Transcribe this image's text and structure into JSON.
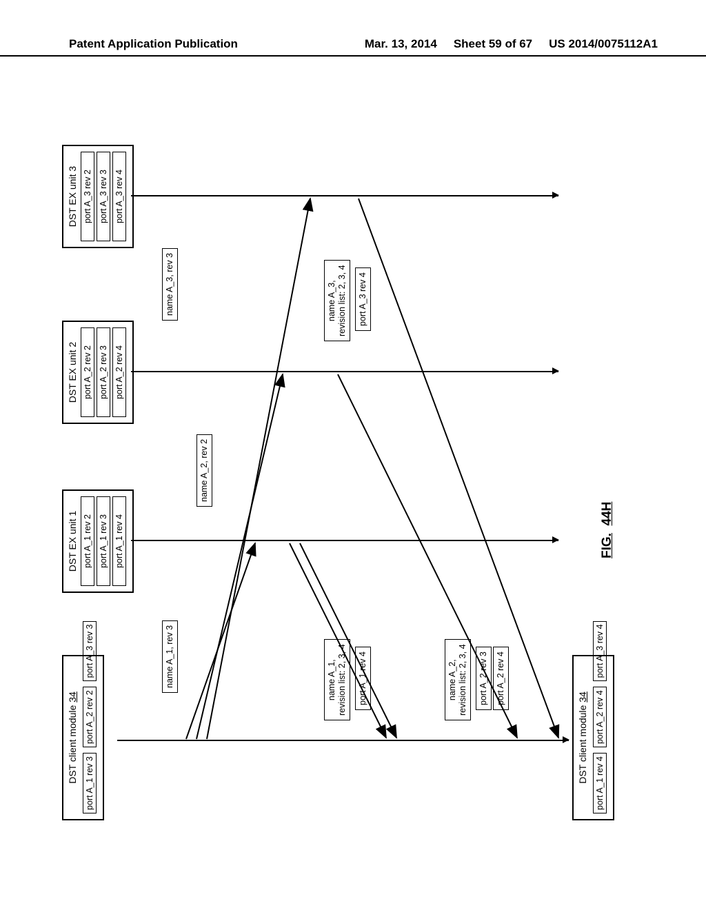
{
  "header": {
    "left": "Patent Application Publication",
    "date": "Mar. 13, 2014",
    "sheet": "Sheet 59 of 67",
    "pubno": "US 2014/0075112A1"
  },
  "figure_label_prefix": "FIG.",
  "figure_label_suffix": "44H",
  "client_top": {
    "title_a": "DST client module ",
    "title_b": "34",
    "slots": [
      "port A_1 rev 3",
      "port A_2 rev 2",
      "port A_3 rev 3"
    ]
  },
  "client_bottom": {
    "title_a": "DST client module ",
    "title_b": "34",
    "slots": [
      "port A_1 rev 4",
      "port A_2 rev 4",
      "port A_3 rev 4"
    ]
  },
  "units": {
    "u1": {
      "title": "DST EX unit 1",
      "slots": [
        "port A_1 rev 2",
        "port A_1 rev 3",
        "port A_1 rev 4"
      ]
    },
    "u2": {
      "title": "DST EX unit 2",
      "slots": [
        "port A_2 rev 2",
        "port A_2 rev 3",
        "port A_2 rev 4"
      ]
    },
    "u3": {
      "title": "DST EX unit 3",
      "slots": [
        "port A_3 rev 2",
        "port A_3 rev 3",
        "port A_3 rev 4"
      ]
    }
  },
  "msgs": {
    "m_a1_r3": "name A_1, rev 3",
    "m_a2_r2": "name A_2, rev 2",
    "m_a3_r3": "name A_3, rev 3",
    "m_a1_list": "name A_1,\nrevision list: 2, 3, 4",
    "m_a1_p4": "port A_1 rev 4",
    "m_a2_list": "name A_2,\nrevision list: 2, 3, 4",
    "m_a2_p3": "port A_2 rev 3",
    "m_a2_p4": "port A_2 rev 4",
    "m_a3_list": "name A_3,\nrevision list: 2, 3, 4",
    "m_a3_p4": "port A_3 rev 4"
  }
}
